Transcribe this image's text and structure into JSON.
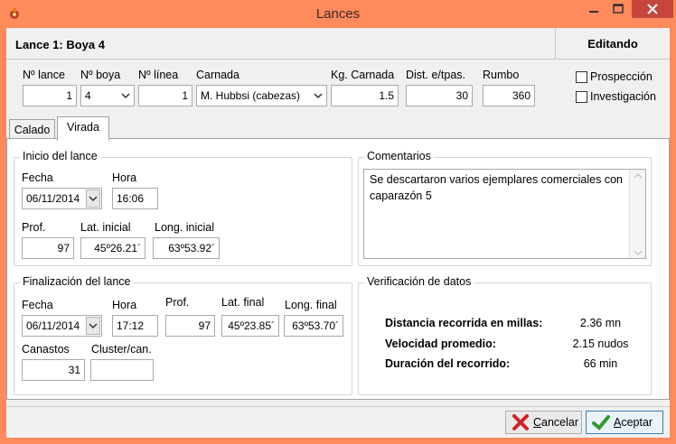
{
  "window": {
    "title": "Lances"
  },
  "header": {
    "title": "Lance 1: Boya 4",
    "status": "Editando"
  },
  "top_fields": {
    "n_lance": {
      "label": "Nº lance",
      "value": "1"
    },
    "n_boya": {
      "label": "Nº boya",
      "value": "4"
    },
    "n_linea": {
      "label": "Nº línea",
      "value": "1"
    },
    "carnada": {
      "label": "Carnada",
      "value": "M. Hubbsi (cabezas)"
    },
    "kg_carnada": {
      "label": "Kg. Carnada",
      "value": "1.5"
    },
    "dist": {
      "label": "Dist. e/tpas.",
      "value": "30"
    },
    "rumbo": {
      "label": "Rumbo",
      "value": "360"
    }
  },
  "checkboxes": {
    "prospeccion": {
      "label": "Prospección",
      "checked": false
    },
    "investigacion": {
      "label": "Investigación",
      "checked": false
    }
  },
  "tabs": [
    {
      "label": "Calado",
      "active": false
    },
    {
      "label": "Virada",
      "active": true
    }
  ],
  "inicio": {
    "title": "Inicio del lance",
    "fecha_label": "Fecha",
    "fecha": "06/11/2014",
    "hora_label": "Hora",
    "hora": "16:06",
    "prof_label": "Prof.",
    "prof": "97",
    "lat_label": "Lat. inicial",
    "lat": "45º26.21´",
    "long_label": "Long. inicial",
    "long": "63º53.92´"
  },
  "comentarios": {
    "title": "Comentarios",
    "text": "Se descartaron varios ejemplares comerciales con caparazón 5"
  },
  "final": {
    "title": "Finalización del lance",
    "fecha_label": "Fecha",
    "fecha": "06/11/2014",
    "hora_label": "Hora",
    "hora": "17:12",
    "prof_label": "Prof.",
    "prof": "97",
    "lat_label": "Lat. final",
    "lat": "45º23.85´",
    "long_label": "Long. final",
    "long": "63º53.70´",
    "canastos_label": "Canastos",
    "canastos": "31",
    "cluster_label": "Cluster/can.",
    "cluster": ""
  },
  "verificacion": {
    "title": "Verificación de datos",
    "rows": [
      {
        "key": "Distancia recorrida en millas:",
        "value": "2.36 mn"
      },
      {
        "key": "Velocidad promedio:",
        "value": "2.15 nudos"
      },
      {
        "key": "Duración del recorrido:",
        "value": "66 min"
      }
    ]
  },
  "buttons": {
    "cancelar": {
      "accel": "C",
      "rest": "ancelar"
    },
    "aceptar": {
      "accel": "A",
      "rest": "ceptar"
    }
  },
  "colors": {
    "frame": "#ff8a5c",
    "close": "#c7463b",
    "accept_icon": "#2e9a2e",
    "cancel_icon": "#d02424"
  }
}
